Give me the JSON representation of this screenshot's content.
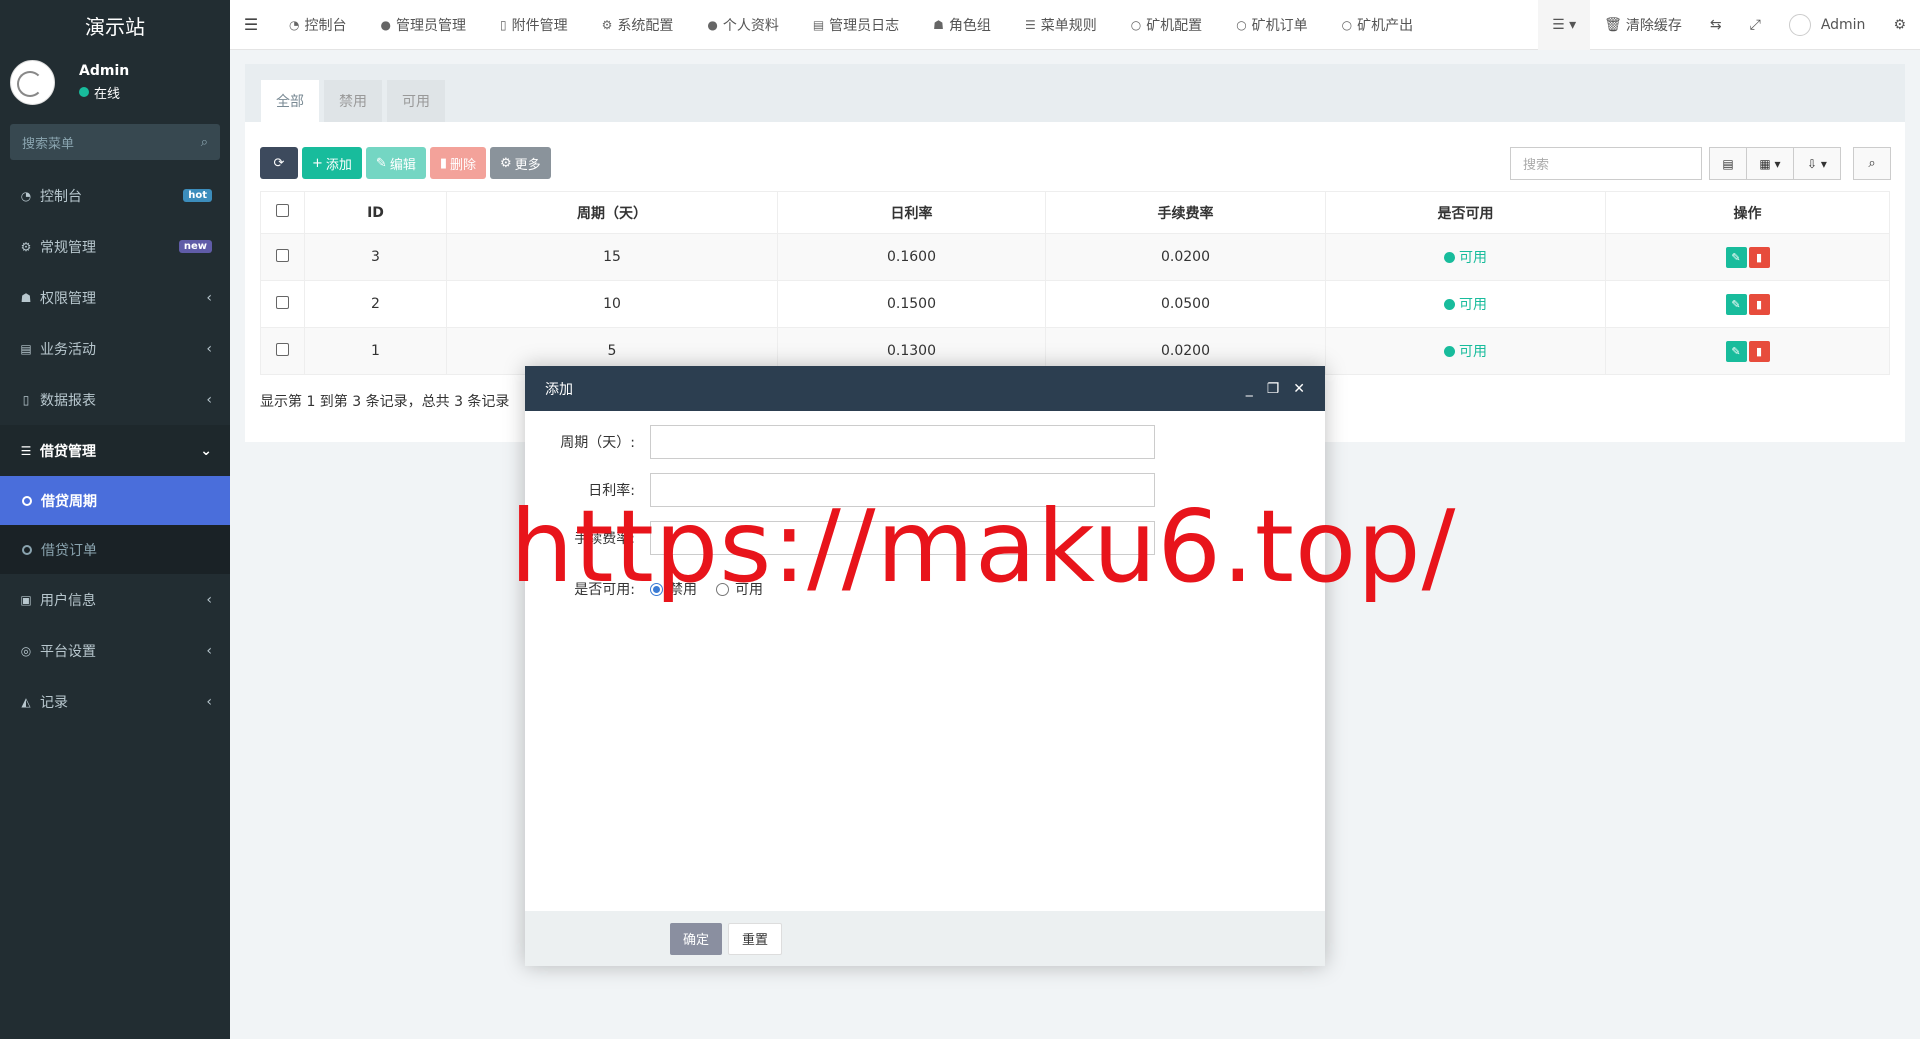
{
  "sidebar": {
    "logo": "演示站",
    "user": {
      "name": "Admin",
      "status": "在线"
    },
    "search_placeholder": "搜索菜单",
    "items": [
      {
        "label": "控制台",
        "badge": "hot"
      },
      {
        "label": "常规管理",
        "badge": "new"
      },
      {
        "label": "权限管理"
      },
      {
        "label": "业务活动"
      },
      {
        "label": "数据报表"
      },
      {
        "label": "借贷管理"
      },
      {
        "label": "用户信息"
      },
      {
        "label": "平台设置"
      },
      {
        "label": "记录"
      }
    ],
    "sub_items": [
      {
        "label": "借贷周期"
      },
      {
        "label": "借贷订单"
      }
    ]
  },
  "topbar": {
    "tabs": [
      "控制台",
      "管理员管理",
      "附件管理",
      "系统配置",
      "个人资料",
      "管理员日志",
      "角色组",
      "菜单规则",
      "矿机配置",
      "矿机订单",
      "矿机产出"
    ],
    "clear_cache": "清除缓存",
    "user": "Admin"
  },
  "panel": {
    "tabs": [
      "全部",
      "禁用",
      "可用"
    ],
    "toolbar": {
      "add": "添加",
      "edit": "编辑",
      "delete": "删除",
      "more": "更多"
    },
    "search_placeholder": "搜索",
    "columns": [
      "ID",
      "周期（天）",
      "日利率",
      "手续费率",
      "是否可用",
      "操作"
    ],
    "rows": [
      {
        "id": "3",
        "period": "15",
        "rate": "0.1600",
        "fee": "0.0200",
        "status": "可用"
      },
      {
        "id": "2",
        "period": "10",
        "rate": "0.1500",
        "fee": "0.0500",
        "status": "可用"
      },
      {
        "id": "1",
        "period": "5",
        "rate": "0.1300",
        "fee": "0.0200",
        "status": "可用"
      }
    ],
    "pager": "显示第 1 到第 3 条记录，总共 3 条记录"
  },
  "dialog": {
    "title": "添加",
    "fields": {
      "period": "周期（天）:",
      "rate": "日利率:",
      "fee": "手续费率:",
      "enabled": "是否可用:"
    },
    "radio": {
      "disabled": "禁用",
      "enabled": "可用"
    },
    "ok": "确定",
    "reset": "重置"
  },
  "watermark": "https://maku6.top/",
  "colors": {
    "primary": "#18bc9c",
    "sidebar": "#222d32",
    "active": "#4a6edb",
    "danger": "#e74c3c",
    "dialog_header": "#2c3e50"
  }
}
